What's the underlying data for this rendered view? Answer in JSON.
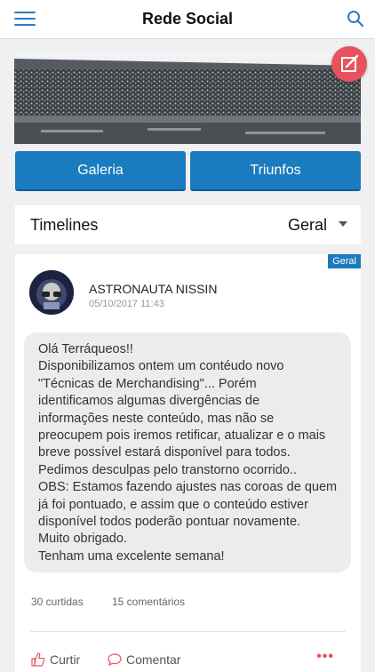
{
  "header": {
    "title": "Rede Social",
    "accent_color": "#2a7cc7"
  },
  "banner": {
    "icon": "stadium-crowd-image"
  },
  "fab": {
    "icon": "edit-icon",
    "color": "#e8525c"
  },
  "buttons": {
    "gallery": "Galeria",
    "triumphs": "Triunfos",
    "color": "#1a7bbf"
  },
  "timelines": {
    "label": "Timelines",
    "selected": "Geral"
  },
  "post": {
    "tag": "Geral",
    "author": "ASTRONAUTA NISSIN",
    "date": "05/10/2017 11:43",
    "lines": [
      "Olá Terráqueos!!",
      "Disponibilizamos ontem um contéudo novo",
      "\"Técnicas de Merchandising\"... Porém",
      "identificamos algumas divergências de",
      "informações neste conteúdo, mas não se",
      "preocupem pois iremos retificar, atualizar e o mais",
      "breve possível estará disponível para todos.",
      "Pedimos desculpas pelo transtorno ocorrido..",
      "OBS: Estamos fazendo ajustes nas coroas de quem",
      "já foi pontuado, e assim que o conteúdo estiver",
      "disponível todos poderão pontuar novamente.",
      "Muito obrigado.",
      "Tenham uma excelente semana!"
    ],
    "likes": "30 curtidas",
    "comments": "15 comentários",
    "like_action": "Curtir",
    "comment_action": "Comentar",
    "more": "•••"
  }
}
